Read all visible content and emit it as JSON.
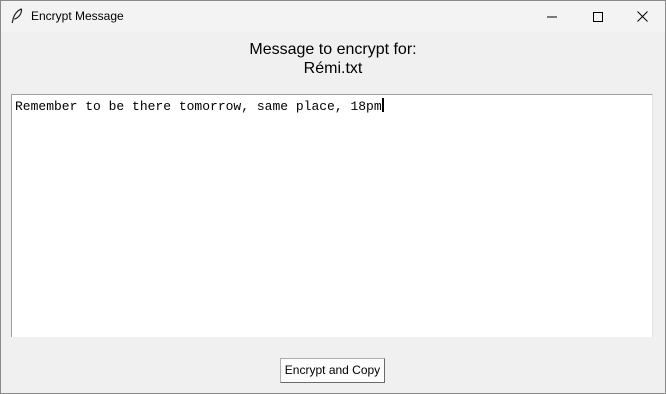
{
  "window": {
    "title": "Encrypt Message",
    "icon": "feather-icon",
    "controls": {
      "minimize_icon": "minimize-icon",
      "maximize_icon": "maximize-icon",
      "close_icon": "close-icon"
    }
  },
  "header": {
    "line1": "Message to encrypt for:",
    "line2": "Rémi.txt"
  },
  "message": {
    "value": "Remember to be there tomorrow, same place, 18pm"
  },
  "actions": {
    "encrypt_label": "Encrypt and Copy"
  },
  "colors": {
    "background": "#f0f0f0",
    "textarea_background": "#ffffff",
    "button_background": "#fdfdfd"
  }
}
